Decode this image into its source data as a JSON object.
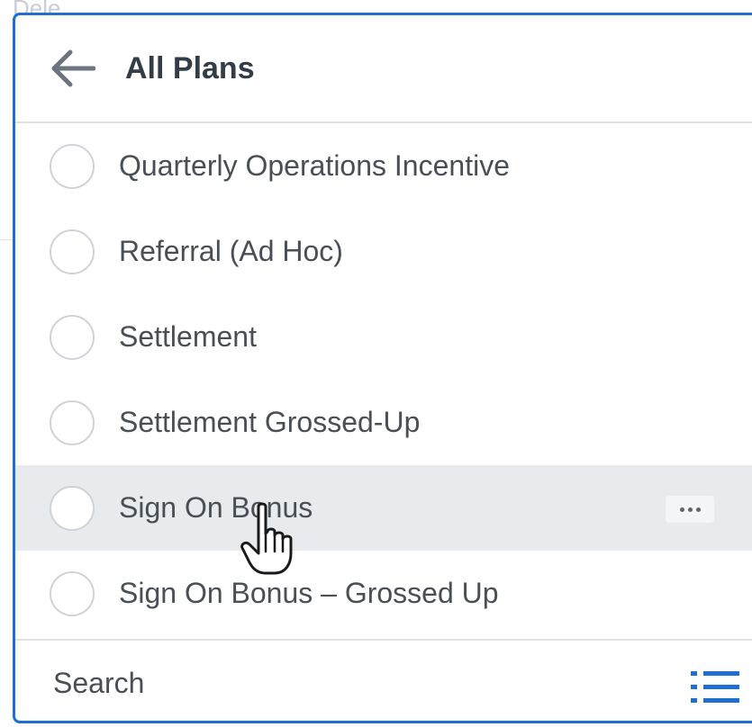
{
  "background": {
    "partial_text": "Dele..."
  },
  "header": {
    "title": "All Plans",
    "back_icon": "arrow-left-icon"
  },
  "plans": [
    {
      "label": "Quarterly Operations Incentive",
      "selected": false
    },
    {
      "label": "Referral (Ad Hoc)",
      "selected": false
    },
    {
      "label": "Settlement",
      "selected": false
    },
    {
      "label": "Settlement Grossed-Up",
      "selected": false
    },
    {
      "label": "Sign On Bonus",
      "selected": false,
      "hovered": true
    },
    {
      "label": "Sign On Bonus – Grossed Up",
      "selected": false
    }
  ],
  "search": {
    "placeholder": "Search",
    "value": ""
  },
  "colors": {
    "accent": "#1f6fd1",
    "hover_row": "#e8ebee",
    "text": "#494f57",
    "title": "#333d47",
    "divider": "#dfe3e8"
  }
}
